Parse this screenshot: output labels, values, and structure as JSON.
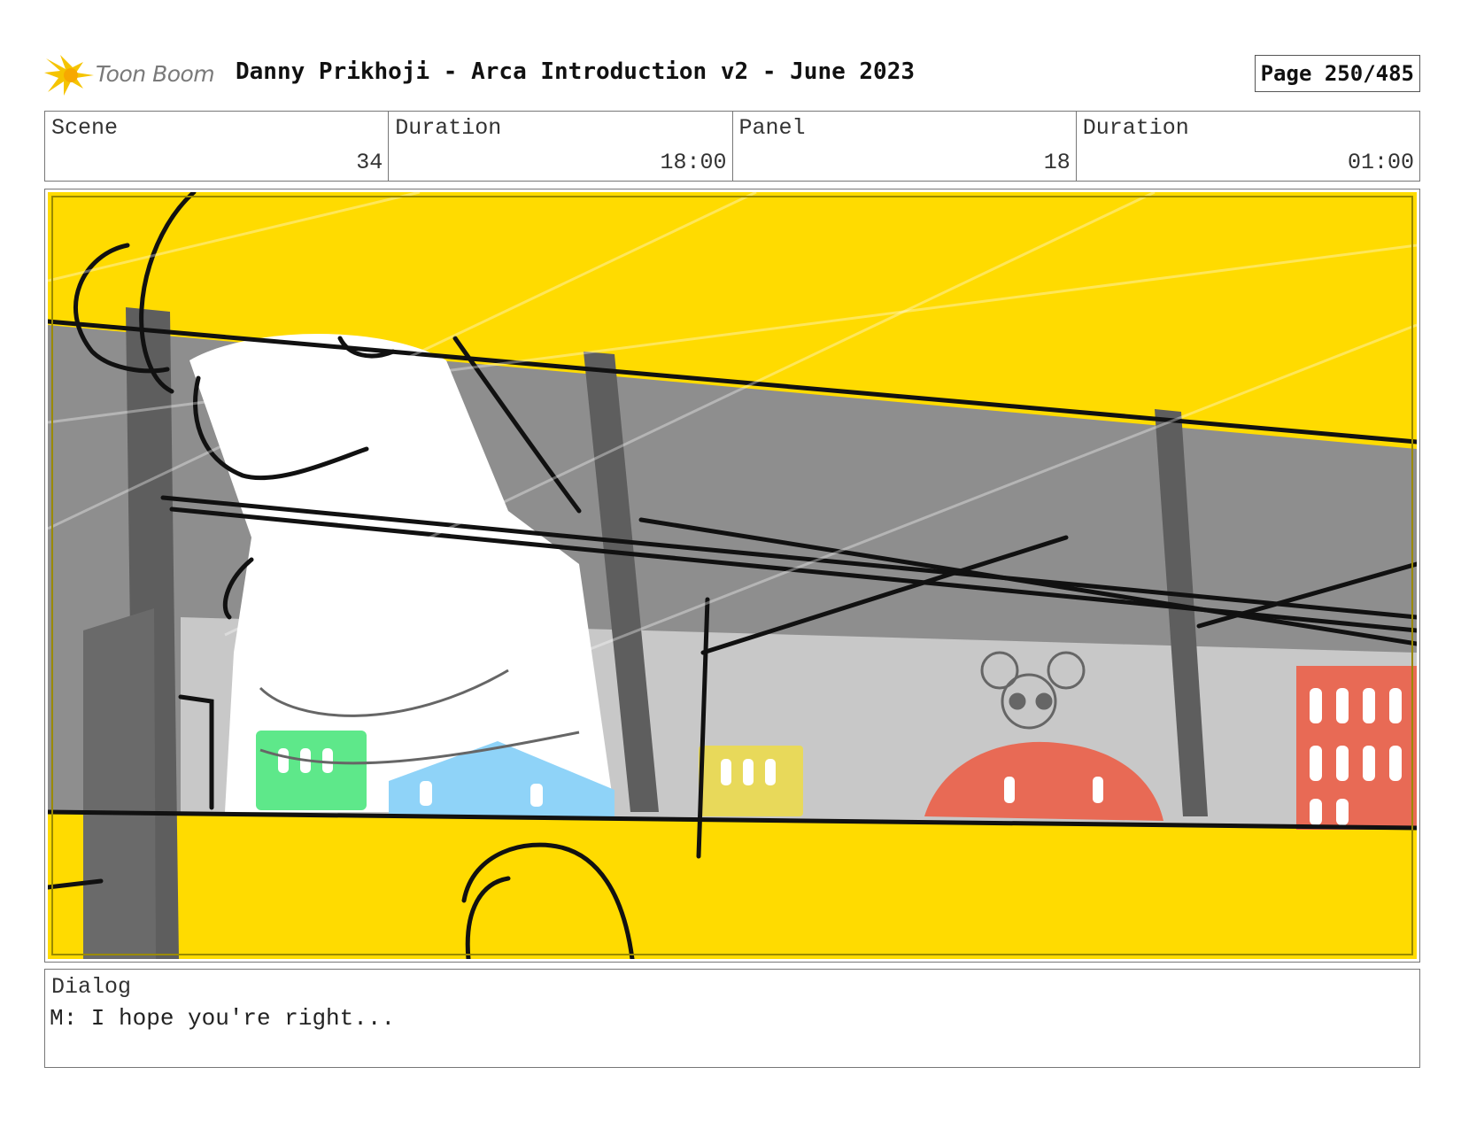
{
  "header": {
    "logo_text": "Toon Boom",
    "title": "Danny Prikhoji - Arca Introduction v2 - June 2023",
    "page_label": "Page 250/485"
  },
  "info": {
    "scene_label": "Scene",
    "scene_value": "34",
    "scene_duration_label": "Duration",
    "scene_duration_value": "18:00",
    "panel_label": "Panel",
    "panel_value": "18",
    "panel_duration_label": "Duration",
    "panel_duration_value": "01:00"
  },
  "dialog": {
    "label": "Dialog",
    "text": "M: I hope you're right..."
  },
  "colors": {
    "bus_yellow": "#FFDB00",
    "window_gray": "#8E8E8E",
    "building_light": "#C8C8C8",
    "green_building": "#5EE88A",
    "blue_building": "#8FD3F8",
    "yellow_building": "#E8D95A",
    "red_building": "#E86A55",
    "logo_yellow": "#F5C400"
  }
}
